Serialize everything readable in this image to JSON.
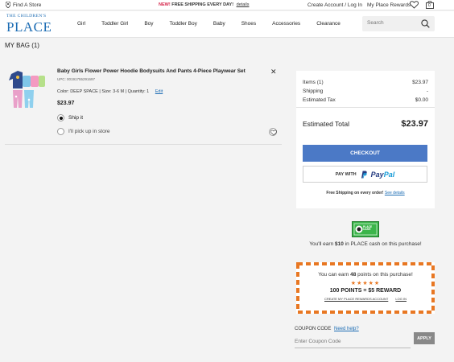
{
  "topbar": {
    "find_store": "Find A Store",
    "promo_new": "NEW!",
    "promo_text": "FREE SHIPPING EVERY DAY!",
    "promo_details": "details",
    "account": "Create Account / Log In",
    "rewards": "My Place Rewards",
    "bag_count": "0"
  },
  "header": {
    "logo_top": "THE CHILDREN'S",
    "logo_bottom": "PLACE",
    "nav": [
      "Girl",
      "Toddler Girl",
      "Boy",
      "Toddler Boy",
      "Baby",
      "Shoes",
      "Accessories",
      "Clearance"
    ],
    "search_placeholder": "Search"
  },
  "page_title": "MY BAG (1)",
  "item": {
    "title": "Baby Girls Flower Power Hoodie Bodysuits And Pants 4-Piece Playwear Set",
    "upc": "UPC: 00191755291697",
    "attributes": "Color: DEEP SPACE  |  Size: 3-6 M  |  Quantity: 1",
    "edit": "Edit",
    "price": "$23.97",
    "ship_option": "Ship it",
    "pickup_option": "I'll pick up in store",
    "remove": "✕"
  },
  "summary": {
    "items_label": "Items (1)",
    "items_value": "$23.97",
    "shipping_label": "Shipping",
    "shipping_value": "-",
    "tax_label": "Estimated Tax",
    "tax_value": "$0.00",
    "total_label": "Estimated Total",
    "total_value": "$23.97",
    "checkout": "CHECKOUT",
    "paypal_prefix": "PAY WITH",
    "paypal_pay": "Pay",
    "paypal_pal": "Pal",
    "free_shipping": "Free Shipping on every order!",
    "see_details": "See details"
  },
  "cash": {
    "badge": "PLACE CASH",
    "text_prefix": "You'll earn ",
    "amount": "$10",
    "text_suffix": " in PLACE cash on this purchase!"
  },
  "points": {
    "earn_prefix": "You can earn ",
    "earn_value": "48",
    "earn_suffix": " points on this purchase!",
    "stars": "★★★★★",
    "reward": "100 POINTS = $5 REWARD",
    "create_link": "CREATE MY PLACE REWARDS ACCOUNT",
    "login_link": "LOG IN"
  },
  "coupon": {
    "label": "COUPON CODE",
    "help": "Need help?",
    "placeholder": "Enter Coupon Code",
    "apply": "APPLY"
  },
  "colors": {
    "brand_blue": "#1d6db4",
    "checkout_blue": "#4b79c6",
    "promo_red": "#d5244a",
    "reward_orange": "#e87722",
    "cash_green": "#3bb54a"
  }
}
